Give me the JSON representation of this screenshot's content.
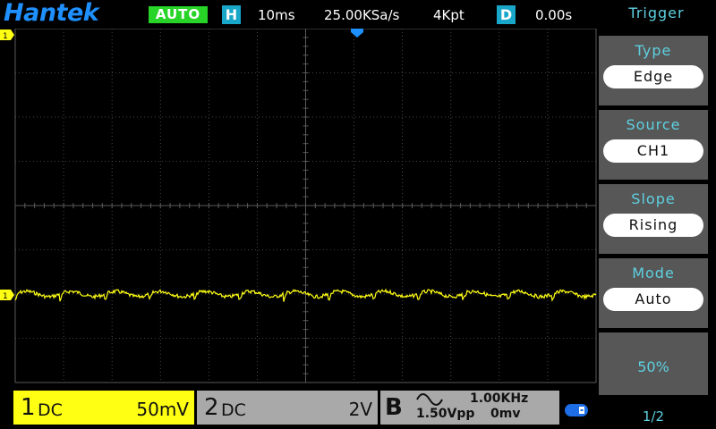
{
  "header": {
    "brand": "Hantek",
    "run_mode": "AUTO",
    "horizontal_badge": "H",
    "timebase": "10ms",
    "sample_rate": "25.00KSa/s",
    "memory_depth": "4Kpt",
    "delay_badge": "D",
    "delay": "0.00s"
  },
  "markers": {
    "trigger_level": "1",
    "channel1_ground": "1"
  },
  "channels": {
    "ch1": {
      "number": "1",
      "coupling": "DC",
      "scale": "50mV",
      "color": "#ffff14"
    },
    "ch2": {
      "number": "2",
      "coupling": "DC",
      "scale": "2V",
      "color": "#a9a9a9"
    }
  },
  "signal_generator": {
    "label": "B",
    "waveform_icon": "sine-wave-icon",
    "frequency": "1.00KHz",
    "amplitude": "1.50Vpp",
    "offset": "0mv"
  },
  "status_icons": {
    "usb": "usb-icon"
  },
  "trigger_menu": {
    "title": "Trigger",
    "items": [
      {
        "label": "Type",
        "value": "Edge"
      },
      {
        "label": "Source",
        "value": "CH1"
      },
      {
        "label": "Slope",
        "value": "Rising"
      },
      {
        "label": "Mode",
        "value": "Auto"
      }
    ],
    "level": "50%",
    "page": "1/2"
  },
  "colors": {
    "grid": "#5a5a5a",
    "trace": "#ffff14",
    "accent": "#5ed0e0",
    "logo": "#1e90ff",
    "auto": "#27d427",
    "badge": "#18a6c9"
  }
}
